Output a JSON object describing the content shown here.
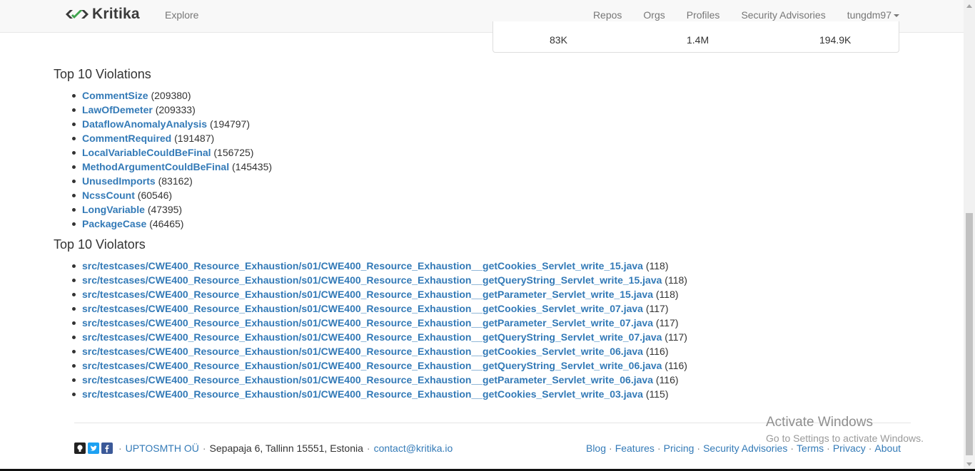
{
  "navbar": {
    "brand": "Kritika",
    "explore": "Explore",
    "links": [
      "Repos",
      "Orgs",
      "Profiles",
      "Security Advisories"
    ],
    "user": "tungdm97"
  },
  "stats": [
    "83K",
    "1.4M",
    "194.9K"
  ],
  "violations": {
    "title": "Top 10 Violations",
    "items": [
      {
        "name": "CommentSize",
        "count": "(209380)"
      },
      {
        "name": "LawOfDemeter",
        "count": "(209333)"
      },
      {
        "name": "DataflowAnomalyAnalysis",
        "count": "(194797)"
      },
      {
        "name": "CommentRequired",
        "count": "(191487)"
      },
      {
        "name": "LocalVariableCouldBeFinal",
        "count": "(156725)"
      },
      {
        "name": "MethodArgumentCouldBeFinal",
        "count": "(145435)"
      },
      {
        "name": "UnusedImports",
        "count": "(83162)"
      },
      {
        "name": "NcssCount",
        "count": "(60546)"
      },
      {
        "name": "LongVariable",
        "count": "(47395)"
      },
      {
        "name": "PackageCase",
        "count": "(46465)"
      }
    ]
  },
  "violators": {
    "title": "Top 10 Violators",
    "items": [
      {
        "path": "src/testcases/CWE400_Resource_Exhaustion/s01/CWE400_Resource_Exhaustion__getCookies_Servlet_write_15.java",
        "count": "(118)"
      },
      {
        "path": "src/testcases/CWE400_Resource_Exhaustion/s01/CWE400_Resource_Exhaustion__getQueryString_Servlet_write_15.java",
        "count": "(118)"
      },
      {
        "path": "src/testcases/CWE400_Resource_Exhaustion/s01/CWE400_Resource_Exhaustion__getParameter_Servlet_write_15.java",
        "count": "(118)"
      },
      {
        "path": "src/testcases/CWE400_Resource_Exhaustion/s01/CWE400_Resource_Exhaustion__getCookies_Servlet_write_07.java",
        "count": "(117)"
      },
      {
        "path": "src/testcases/CWE400_Resource_Exhaustion/s01/CWE400_Resource_Exhaustion__getParameter_Servlet_write_07.java",
        "count": "(117)"
      },
      {
        "path": "src/testcases/CWE400_Resource_Exhaustion/s01/CWE400_Resource_Exhaustion__getQueryString_Servlet_write_07.java",
        "count": "(117)"
      },
      {
        "path": "src/testcases/CWE400_Resource_Exhaustion/s01/CWE400_Resource_Exhaustion__getCookies_Servlet_write_06.java",
        "count": "(116)"
      },
      {
        "path": "src/testcases/CWE400_Resource_Exhaustion/s01/CWE400_Resource_Exhaustion__getQueryString_Servlet_write_06.java",
        "count": "(116)"
      },
      {
        "path": "src/testcases/CWE400_Resource_Exhaustion/s01/CWE400_Resource_Exhaustion__getParameter_Servlet_write_06.java",
        "count": "(116)"
      },
      {
        "path": "src/testcases/CWE400_Resource_Exhaustion/s01/CWE400_Resource_Exhaustion__getCookies_Servlet_write_03.java",
        "count": "(115)"
      }
    ]
  },
  "footer": {
    "company": "UPTOSMTH OÜ",
    "address": "Sepapaja 6, Tallinn 15551, Estonia",
    "email": "contact@kritika.io",
    "links": [
      "Blog",
      "Features",
      "Pricing",
      "Security Advisories",
      "Terms",
      "Privacy",
      "About"
    ],
    "separator": "·",
    "social_icons": [
      "github-icon",
      "twitter-icon",
      "facebook-icon"
    ]
  },
  "watermark": {
    "title": "Activate Windows",
    "subtitle": "Go to Settings to activate Windows."
  },
  "colors": {
    "link": "#337ab7",
    "navbar_bg": "#f8f8f8",
    "brand_green": "#3fa34d",
    "twitter": "#1da1f2",
    "facebook": "#3b5998"
  }
}
